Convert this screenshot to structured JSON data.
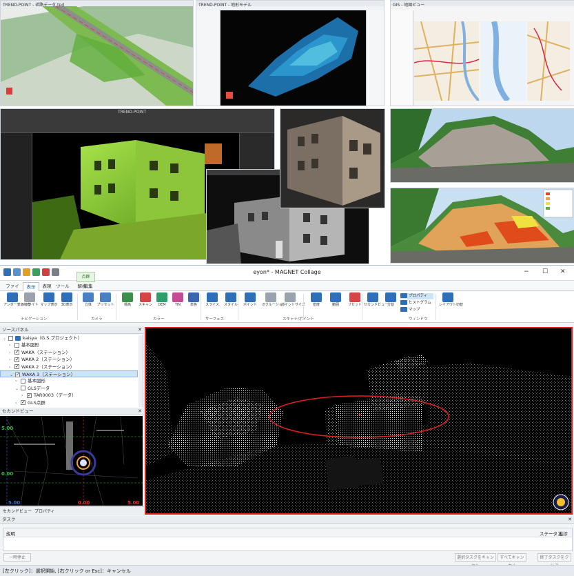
{
  "top_collage": {
    "panel_1": {
      "window_title": "TREND-POINT - 道路データ.tpd"
    },
    "panel_2": {
      "window_title": "TREND-POINT - 地形モデル"
    },
    "panel_3": {
      "window_title": "GIS - 地図ビュー"
    },
    "panel_4": {
      "window_title": "TREND-POINT"
    }
  },
  "app": {
    "title": "eyon* - MAGNET Collage",
    "window_controls": {
      "minimize": "−",
      "maximize": "☐",
      "close": "✕"
    },
    "quick_access": [
      "file-icon",
      "save-icon",
      "undo-icon",
      "redo-icon",
      "grid-icon",
      "settings-icon"
    ],
    "tabs": [
      {
        "label": "ファイル"
      },
      {
        "label": "表示"
      },
      {
        "label": "表現"
      },
      {
        "label": "ツール"
      },
      {
        "label": "解析"
      },
      {
        "label": "編集"
      }
    ],
    "context_tab": "点群",
    "ribbon": {
      "buttons": [
        {
          "label": "アンダー表示切替",
          "icon": "layers-icon",
          "color": "#2f6fb8"
        },
        {
          "label": "ハイライト",
          "icon": "highlight-icon",
          "color": "#9aa3ad"
        },
        {
          "label": "マップ表示",
          "icon": "map-icon",
          "color": "#2f6fb8"
        },
        {
          "label": "3D表示",
          "icon": "cube-icon",
          "color": "#2f6fb8"
        },
        {
          "label": "立体",
          "icon": "box-icon",
          "color": "#4a7fc1"
        },
        {
          "label": "プリセット",
          "icon": "preset-icon",
          "color": "#4a7fc1"
        },
        {
          "label": "標高",
          "icon": "elevation-icon",
          "color": "#3b8f4a"
        },
        {
          "label": "スキャン",
          "icon": "scan-icon",
          "color": "#d64545"
        },
        {
          "label": "DEM",
          "icon": "dem-icon",
          "color": "#2e9f6a"
        },
        {
          "label": "TIN",
          "icon": "tin-icon",
          "color": "#c24b94"
        },
        {
          "label": "単色",
          "icon": "solid-icon",
          "color": "#3a66b0"
        },
        {
          "label": "スライス",
          "icon": "slice-icon",
          "color": "#2f6fb8"
        },
        {
          "label": "スタイル",
          "icon": "point-style-icon",
          "color": "#2f6fb8"
        },
        {
          "label": "ポイント",
          "icon": "target-icon",
          "color": "#2f6fb8"
        },
        {
          "label": "オクルージョン",
          "icon": "occlusion-icon",
          "color": "#9aa3ad"
        },
        {
          "label": "ポイントサイズ",
          "icon": "point-size-icon",
          "color": "#9aa3ad"
        },
        {
          "label": "密度",
          "icon": "density-icon",
          "color": "#2f6fb8"
        },
        {
          "label": "範囲",
          "icon": "range-icon",
          "color": "#2f6fb8"
        },
        {
          "label": "リセット",
          "icon": "reset-icon",
          "color": "#d64545"
        },
        {
          "label": "セカンドビュー",
          "icon": "window-icon",
          "color": "#2f6fb8"
        },
        {
          "label": "分割",
          "icon": "split-icon",
          "color": "#2f6fb8"
        },
        {
          "label": "レイアウト切替",
          "icon": "layout-icon",
          "color": "#2f6fb8"
        }
      ],
      "small_items": [
        "プロパティ",
        "ヒストグラム",
        "マップ"
      ],
      "groups": [
        "ナビゲーション",
        "カメラ",
        "カラー",
        "サーフェス",
        "スキャナ/ポイント",
        "ウィンドウ"
      ]
    },
    "source_panel": {
      "title": "ソースパネル",
      "items": [
        {
          "label": "kaisya（G.S.プロジェクト）",
          "depth": 0,
          "checked": false,
          "expanded": true
        },
        {
          "label": "基本図形",
          "depth": 1,
          "checked": false,
          "expanded": false
        },
        {
          "label": "WAKA（ステーション）",
          "depth": 1,
          "checked": true,
          "expanded": false
        },
        {
          "label": "WAKA 2（ステーション）",
          "depth": 1,
          "checked": true,
          "expanded": false
        },
        {
          "label": "WAKA 2（ステーション）",
          "depth": 1,
          "checked": true,
          "expanded": false
        },
        {
          "label": "WAKA 3（ステーション）",
          "depth": 1,
          "checked": true,
          "expanded": true,
          "selected": true
        },
        {
          "label": "基本図形",
          "depth": 2,
          "checked": false,
          "expanded": false
        },
        {
          "label": "GLSデータ",
          "depth": 2,
          "checked": false,
          "expanded": true
        },
        {
          "label": "TAR0003（データ）",
          "depth": 3,
          "checked": true,
          "expanded": false
        },
        {
          "label": "GLS点群",
          "depth": 2,
          "checked": true,
          "expanded": false
        }
      ]
    },
    "second_view": {
      "title": "セカンドビュー",
      "axis_labels": [
        "5.00",
        "0.00",
        "5.00",
        "0.00",
        "5.00"
      ],
      "tabs": [
        "セカンドビュー",
        "プロパティ"
      ]
    },
    "task_panel": {
      "title": "タスク",
      "columns": [
        "説明",
        "ステータス",
        "進捗"
      ],
      "buttons": [
        "一時停止",
        "選択タスクをキャンセル",
        "すべてキャンセル",
        "終了タスクをクリア"
      ]
    },
    "status_bar": "[左クリック]：選択開始, [右クリック or Esc]：キャンセル",
    "colors": {
      "highlight": "#e02020",
      "selection": "#cfe3f7",
      "accent": "#0a5bb5"
    }
  }
}
